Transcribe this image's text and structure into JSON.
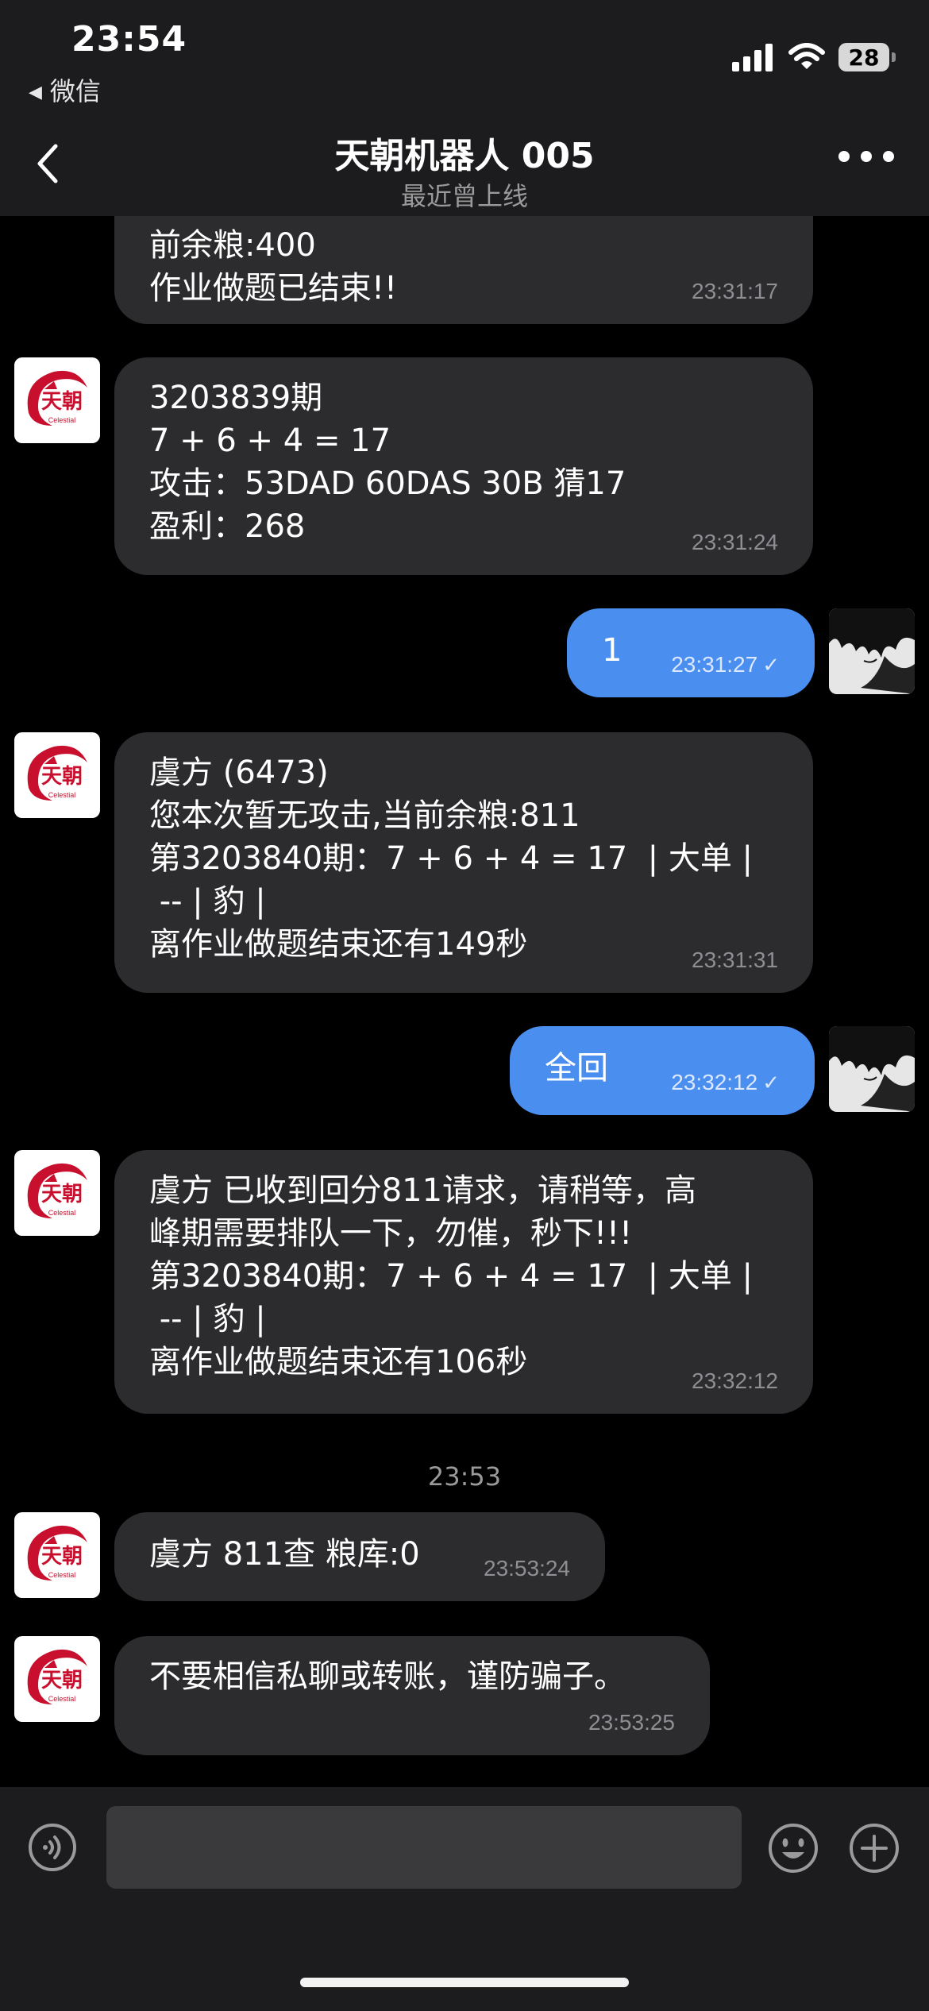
{
  "status_bar": {
    "time": "23:54",
    "back_app": "微信",
    "battery": "28"
  },
  "nav": {
    "title": "天朝机器人 005",
    "subtitle": "最近曾上线"
  },
  "messages": [
    {
      "lines": [
        "前余粮:400",
        "作业做题已结束!!"
      ],
      "time": "23:31:17"
    },
    {
      "lines": [
        "3203839期",
        "7 + 6 + 4 = 17",
        "攻击：53DAD 60DAS 30B 猜17",
        "盈利：268"
      ],
      "time": "23:31:24"
    },
    {
      "text": "1",
      "time": "23:31:27"
    },
    {
      "lines": [
        "虞方 (6473)",
        "您本次暂无攻击,当前余粮:811",
        "第3203840期：7 + 6 + 4 = 17  | 大单 |",
        " -- | 豹 |",
        "离作业做题结束还有149秒"
      ],
      "time": "23:31:31"
    },
    {
      "text": "全回",
      "time": "23:32:12"
    },
    {
      "lines": [
        "虞方 已收到回分811请求，请稍等，高",
        "峰期需要排队一下，勿催，秒下!!!",
        "第3203840期：7 + 6 + 4 = 17  | 大单 |",
        " -- | 豹 |",
        "离作业做题结束还有106秒"
      ],
      "time": "23:32:12"
    },
    {
      "lines": [
        "虞方 811查 粮库:0"
      ],
      "time": "23:53:24"
    },
    {
      "lines": [
        "不要相信私聊或转账，谨防骗子。"
      ],
      "time": "23:53:25"
    }
  ],
  "separator_time": "23:53",
  "bot_avatar_text": "天朝",
  "bot_avatar_sub": "Celestial",
  "colors": {
    "accent_blue": "#4a8ef0",
    "bubble_dark": "#2c2c2e",
    "header_bg": "#1c1c1e",
    "logo_red": "#c8102e"
  },
  "icons": [
    "wechat-voice-icon",
    "emoji-icon",
    "plus-icon",
    "more-icon",
    "back-chevron-icon",
    "signal-icon",
    "wifi-icon",
    "battery-icon",
    "read-check-icon"
  ]
}
